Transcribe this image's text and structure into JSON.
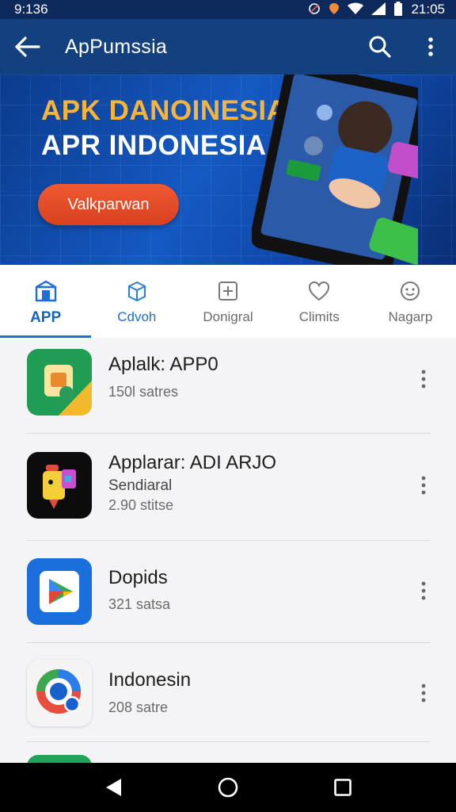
{
  "status_bar": {
    "left_time": "9:136",
    "right_time": "21:05",
    "icons": [
      "mute-icon",
      "location-icon",
      "wifi-icon",
      "signal-icon",
      "battery-icon"
    ]
  },
  "app_bar": {
    "title": "ApPumssia",
    "icons": [
      "back-arrow-icon",
      "search-icon",
      "more-vert-icon"
    ]
  },
  "banner": {
    "line1": "APK DANOINESIA",
    "line2": "APR INDONESIA",
    "cta": "Valkparwan",
    "colors": {
      "line1": "#f6b43a",
      "cta": "#e44b27",
      "background": "#1559c3"
    }
  },
  "tabs": [
    {
      "label": "APP",
      "icon": "store-icon",
      "active": true
    },
    {
      "label": "Cdvoh",
      "icon": "box-icon",
      "active": false
    },
    {
      "label": "Donigral",
      "icon": "plus-square-icon",
      "active": false
    },
    {
      "label": "Climits",
      "icon": "heart-icon",
      "active": false
    },
    {
      "label": "Nagarp",
      "icon": "smile-icon",
      "active": false
    }
  ],
  "apps": [
    {
      "name": "Aplalk: APP0",
      "sub": "",
      "meta": "150l satres",
      "icon": "green-chat-app-icon"
    },
    {
      "name": "Applarar: ADI ARJO",
      "sub": "Sendiaral",
      "meta": "2.90 stitse",
      "icon": "robot-app-icon"
    },
    {
      "name": "Dopids",
      "sub": "",
      "meta": "321 satsa",
      "icon": "play-store-app-icon"
    },
    {
      "name": "Indonesin",
      "sub": "",
      "meta": "208 satre",
      "icon": "search-lens-app-icon"
    }
  ],
  "nav_bar": {
    "icons": [
      "nav-back-icon",
      "nav-home-icon",
      "nav-recents-icon"
    ]
  },
  "accent_color": "#1e6fd9"
}
